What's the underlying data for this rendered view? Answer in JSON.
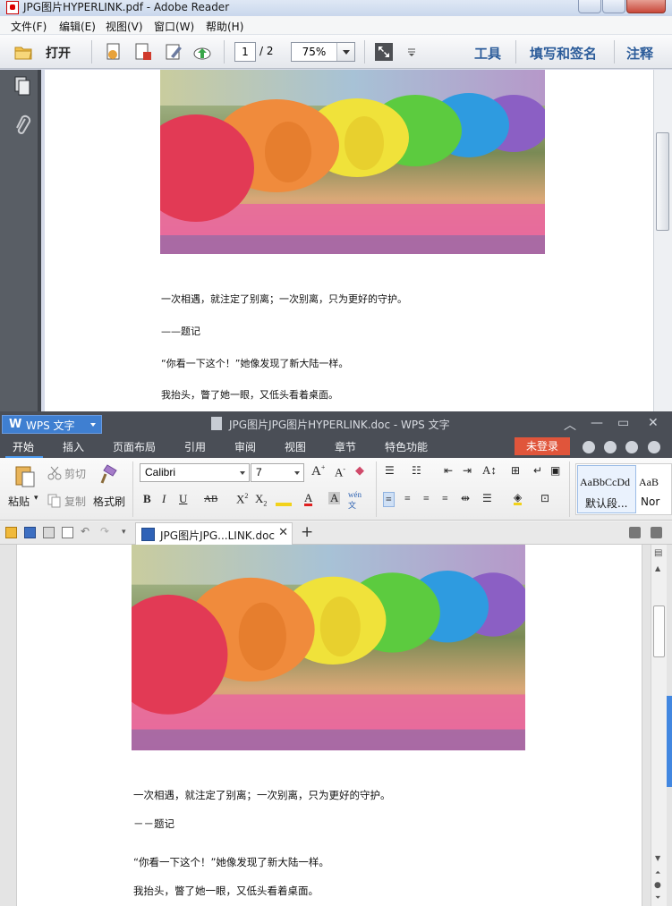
{
  "reader": {
    "window_title": "JPG图片HYPERLINK.pdf - Adobe Reader",
    "menu": [
      "文件(F)",
      "编辑(E)",
      "视图(V)",
      "窗口(W)",
      "帮助(H)"
    ],
    "toolbar": {
      "open_label": "打开",
      "page_current": "1",
      "page_total": "/ 2",
      "zoom": "75%",
      "right_links": [
        "工具",
        "填写和签名",
        "注释"
      ]
    },
    "document": {
      "lines": [
        "一次相遇，就注定了别离；一次别离，只为更好的守护。",
        "——题记",
        "“你看一下这个！”她像发现了新大陆一样。",
        "我抬头，瞥了她一眼，又低头看着桌面。"
      ]
    }
  },
  "wps": {
    "app_label": "WPS 文字",
    "window_title": "JPG图片JPG图片HYPERLINK.doc - WPS 文字",
    "tabs": [
      "开始",
      "插入",
      "页面布局",
      "引用",
      "审阅",
      "视图",
      "章节",
      "特色功能"
    ],
    "login_label": "未登录",
    "ribbon": {
      "paste": "粘贴",
      "cut": "剪切",
      "copy": "复制",
      "format_painter": "格式刷",
      "font_name": "Calibri",
      "font_size": "7",
      "styles": [
        {
          "preview": "AaBbCcDd",
          "name": "默认段..."
        },
        {
          "preview": "AaB",
          "name": "Nor"
        }
      ]
    },
    "doc_tab": "JPG图片JPG...LINK.doc",
    "document": {
      "lines": [
        "一次相遇，就注定了别离；一次别离，只为更好的守护。",
        "－－题记",
        "“你看一下这个！”她像发现了新大陆一样。",
        "我抬头，瞥了她一眼，又低头看着桌面。"
      ]
    }
  },
  "colors": {
    "wps_title_bg": "#4a4e56",
    "wps_accent": "#3f7fd1",
    "wps_login": "#e0553b",
    "reader_link": "#2c5c9a"
  }
}
